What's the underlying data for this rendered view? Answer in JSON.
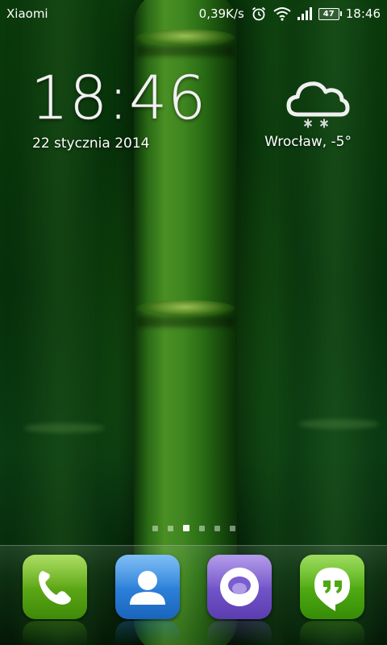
{
  "status_bar": {
    "carrier": "Xiaomi",
    "net_speed": "0,39K/s",
    "battery_level": "47",
    "time": "18:46",
    "icons": [
      "alarm-clock-icon",
      "wifi-icon",
      "signal-icon",
      "battery-icon"
    ]
  },
  "clock_widget": {
    "time": "18:46",
    "date": "22 stycznia 2014"
  },
  "weather_widget": {
    "icon": "cloud-snow-icon",
    "location_temp": "Wrocław, -5°"
  },
  "page_indicator": {
    "total_pages": 6,
    "active_page": 3
  },
  "dock": {
    "apps": [
      {
        "icon": "phone-icon",
        "color": "#5aa514"
      },
      {
        "icon": "contacts-icon",
        "color": "#2b7fd8"
      },
      {
        "icon": "browser-icon",
        "color": "#7153c8"
      },
      {
        "icon": "hangouts-icon",
        "color": "#4ea812"
      }
    ]
  },
  "colors": {
    "wallpaper_green": "#0a3a0b",
    "text": "#ffffff"
  }
}
